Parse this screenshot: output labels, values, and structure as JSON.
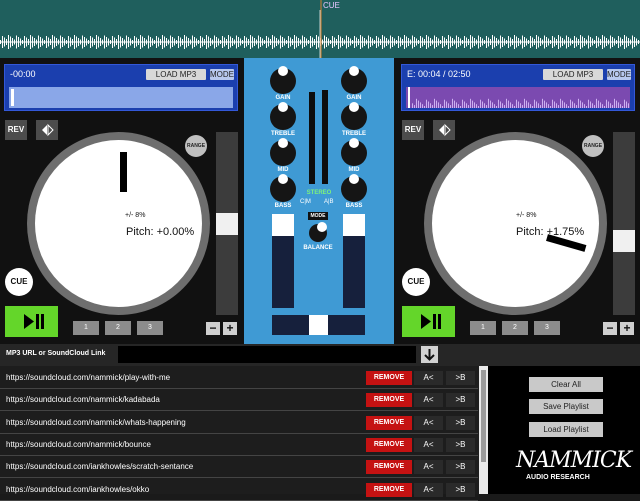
{
  "overview": {
    "cue_label": "CUE"
  },
  "left_deck": {
    "time": "-00:00",
    "load_label": "LOAD MP3",
    "mode_label": "MODE",
    "rev_label": "REV",
    "range_label": "RANGE",
    "pitch_range": "+/- 8%",
    "pitch_text": "Pitch: +0.00%",
    "cue_label": "CUE",
    "hot_cues": [
      "1",
      "2",
      "3"
    ],
    "minus": "−",
    "plus": "+"
  },
  "right_deck": {
    "time": "E: 00:04 / 02:50",
    "load_label": "LOAD MP3",
    "mode_label": "MODE",
    "rev_label": "REV",
    "range_label": "RANGE",
    "pitch_range": "+/- 8%",
    "pitch_text": "Pitch: +1.75%",
    "cue_label": "CUE",
    "hot_cues": [
      "1",
      "2",
      "3"
    ],
    "minus": "−",
    "plus": "+"
  },
  "mixer": {
    "left_labels": [
      "GAIN",
      "TREBLE",
      "MID",
      "BASS"
    ],
    "right_labels": [
      "GAIN",
      "TREBLE",
      "MID",
      "BASS"
    ],
    "stereo_label": "STEREO",
    "cm_label": "C|M",
    "ab_label": "A|B",
    "mode_label": "MODE",
    "balance_label": "BALANCE",
    "colors": {
      "panel": "#3f9ad4",
      "stereo": "#7df07d"
    }
  },
  "url_bar": {
    "label": "MP3 URL or SoundCloud Link",
    "value": "",
    "go_icon": "arrow-down-icon"
  },
  "playlist": {
    "rows": [
      {
        "url": "https://soundcloud.com/nammick/play-with-me"
      },
      {
        "url": "https://soundcloud.com/nammick/kadabada"
      },
      {
        "url": "https://soundcloud.com/nammick/whats-happening"
      },
      {
        "url": "https://soundcloud.com/nammick/bounce"
      },
      {
        "url": "https://soundcloud.com/iankhowles/scratch-sentance"
      },
      {
        "url": "https://soundcloud.com/iankhowles/okko"
      }
    ],
    "remove_label": "REMOVE",
    "a_label": "A<",
    "b_label": ">B"
  },
  "side_panel": {
    "clear_all": "Clear All",
    "save_playlist": "Save Playlist",
    "load_playlist": "Load Playlist",
    "logo_text": "NAMMICK",
    "logo_sub": "AUDIO RESEARCH"
  }
}
